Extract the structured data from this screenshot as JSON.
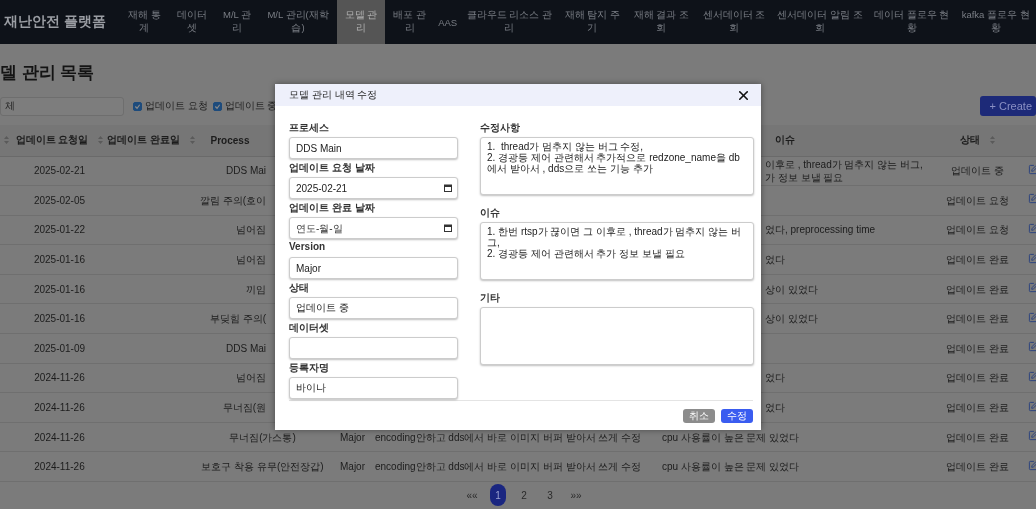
{
  "nav": {
    "title": "재난안전 플랫폼",
    "items": [
      {
        "label": "재해 통계",
        "selected": false
      },
      {
        "label": "데이터셋",
        "selected": false
      },
      {
        "label": "M/L 관리",
        "selected": false
      },
      {
        "label": "M/L 관리(재학습)",
        "selected": false
      },
      {
        "label": "모델 관리",
        "selected": true
      },
      {
        "label": "배포 관리",
        "selected": false
      },
      {
        "label": "AAS",
        "selected": false
      },
      {
        "label": "클라우드 리소스 관리",
        "selected": false
      },
      {
        "label": "재해 탐지 주기",
        "selected": false
      },
      {
        "label": "재해 결과 조회",
        "selected": false
      },
      {
        "label": "센서데이터 조회",
        "selected": false
      },
      {
        "label": "센서데이터 알림 조회",
        "selected": false
      },
      {
        "label": "데이터 플로우 현황",
        "selected": false
      },
      {
        "label": "kafka 플로우 현황",
        "selected": false
      }
    ]
  },
  "page_title": "델 관리 목록",
  "search": {
    "value": "체"
  },
  "filters": [
    {
      "label": "업데이트 요청",
      "checked": true
    },
    {
      "label": "업데이트 중",
      "checked": true
    }
  ],
  "create_button": "+ Create",
  "table": {
    "columns": [
      {
        "sortable": true
      },
      {
        "label": "업데이트 요청일",
        "sortable": true
      },
      {
        "label": "업데이트 완료일",
        "sortable": true
      },
      {
        "label": "Process"
      },
      {},
      {},
      {
        "label": "이슈"
      },
      {
        "label": "상태",
        "sortable": true
      },
      {}
    ],
    "rows": [
      {
        "requested": "2025-02-21",
        "process": "DDS Mai",
        "issue": "이후로 , thread가 멈추지 않는 버그,\n가 정보 보낼 필요",
        "status": "업데이트 중",
        "under_dialog": true
      },
      {
        "requested": "2025-02-05",
        "process": "깔림 주의(호이",
        "status": "업데이트 요청",
        "under_dialog": true
      },
      {
        "requested": "2025-01-22",
        "process": "넘어짐",
        "issue": "었다, preprocessing time",
        "status": "업데이트 요청",
        "under_dialog": true
      },
      {
        "requested": "2025-01-16",
        "process": "넘어짐",
        "issue": "었다",
        "status": "업데이트 완료",
        "under_dialog": true
      },
      {
        "requested": "2025-01-16",
        "process": "끼임",
        "issue": "상이 있었다",
        "status": "업데이트 완료",
        "under_dialog": true
      },
      {
        "requested": "2025-01-16",
        "process": "부딪힘 주의(",
        "issue": "상이 있었다",
        "status": "업데이트 완료",
        "under_dialog": true
      },
      {
        "requested": "2025-01-09",
        "process": "DDS Mai",
        "status": "업데이트 완료",
        "under_dialog": true
      },
      {
        "requested": "2024-11-26",
        "process": "넘어짐",
        "issue": "었다",
        "status": "업데이트 완료",
        "under_dialog": true
      },
      {
        "requested": "2024-11-26",
        "process": "무너짐(원",
        "issue": "었다",
        "status": "업데이트 완료",
        "under_dialog": true
      },
      {
        "requested": "2024-11-26",
        "process": "무너짐(가스통)",
        "version": "Major",
        "update": "encoding안하고 dds에서 바로 이미지 버퍼 받아서 쓰게 수정",
        "issue": "cpu 사용률이 높은 문제 있었다",
        "status": "업데이트 완료",
        "under_dialog": false
      },
      {
        "requested": "2024-11-26",
        "process": "보호구 착용 유무(안전장갑)",
        "version": "Major",
        "update": "encoding안하고 dds에서 바로 이미지 버퍼 받아서 쓰게 수정",
        "issue": "cpu 사용률이 높은 문제 있었다",
        "status": "업데이트 완료",
        "under_dialog": false
      }
    ]
  },
  "pagination": {
    "prev": "««",
    "next": "»»",
    "pages": [
      {
        "label": "1",
        "selected": true
      },
      {
        "label": "2",
        "selected": false
      },
      {
        "label": "3",
        "selected": false
      }
    ]
  },
  "dialog": {
    "title": "모델 관리 내역 수정",
    "fields": [
      {
        "kind": "text",
        "label": "프로세스",
        "value": "DDS Main"
      },
      {
        "kind": "date",
        "label": "업데이트 요청 날짜",
        "value": "2025-02-21"
      },
      {
        "kind": "date",
        "label": "업데이트 완료 날짜",
        "placeholder": "연도-월-일"
      },
      {
        "kind": "text",
        "label": "Version",
        "value": "Major"
      },
      {
        "kind": "text",
        "label": "상태",
        "value": "업데이트 중"
      },
      {
        "kind": "text",
        "label": "데이터셋"
      },
      {
        "kind": "text",
        "label": "등록자명",
        "value": "바이나"
      }
    ],
    "notes": [
      {
        "label": "수정사항",
        "value": "1.  thread가 멈추지 않는 버그 수정,\n2. 경광등 제어 관련해서 추가적으로 redzone_name을 db에서 받아서 , dds으로 쏘는 기능 추가"
      },
      {
        "label": "이슈",
        "value": "1. 한번 rtsp가 끊이면 그 이후로 , thread가 멈추지 않는 버그,\n2. 경광등 제어 관련해서 추가 정보 보낼 필요"
      },
      {
        "label": "기타"
      }
    ],
    "buttons": [
      {
        "kind": "cancel",
        "label": "취소"
      },
      {
        "kind": "submit",
        "label": "수정"
      }
    ]
  }
}
